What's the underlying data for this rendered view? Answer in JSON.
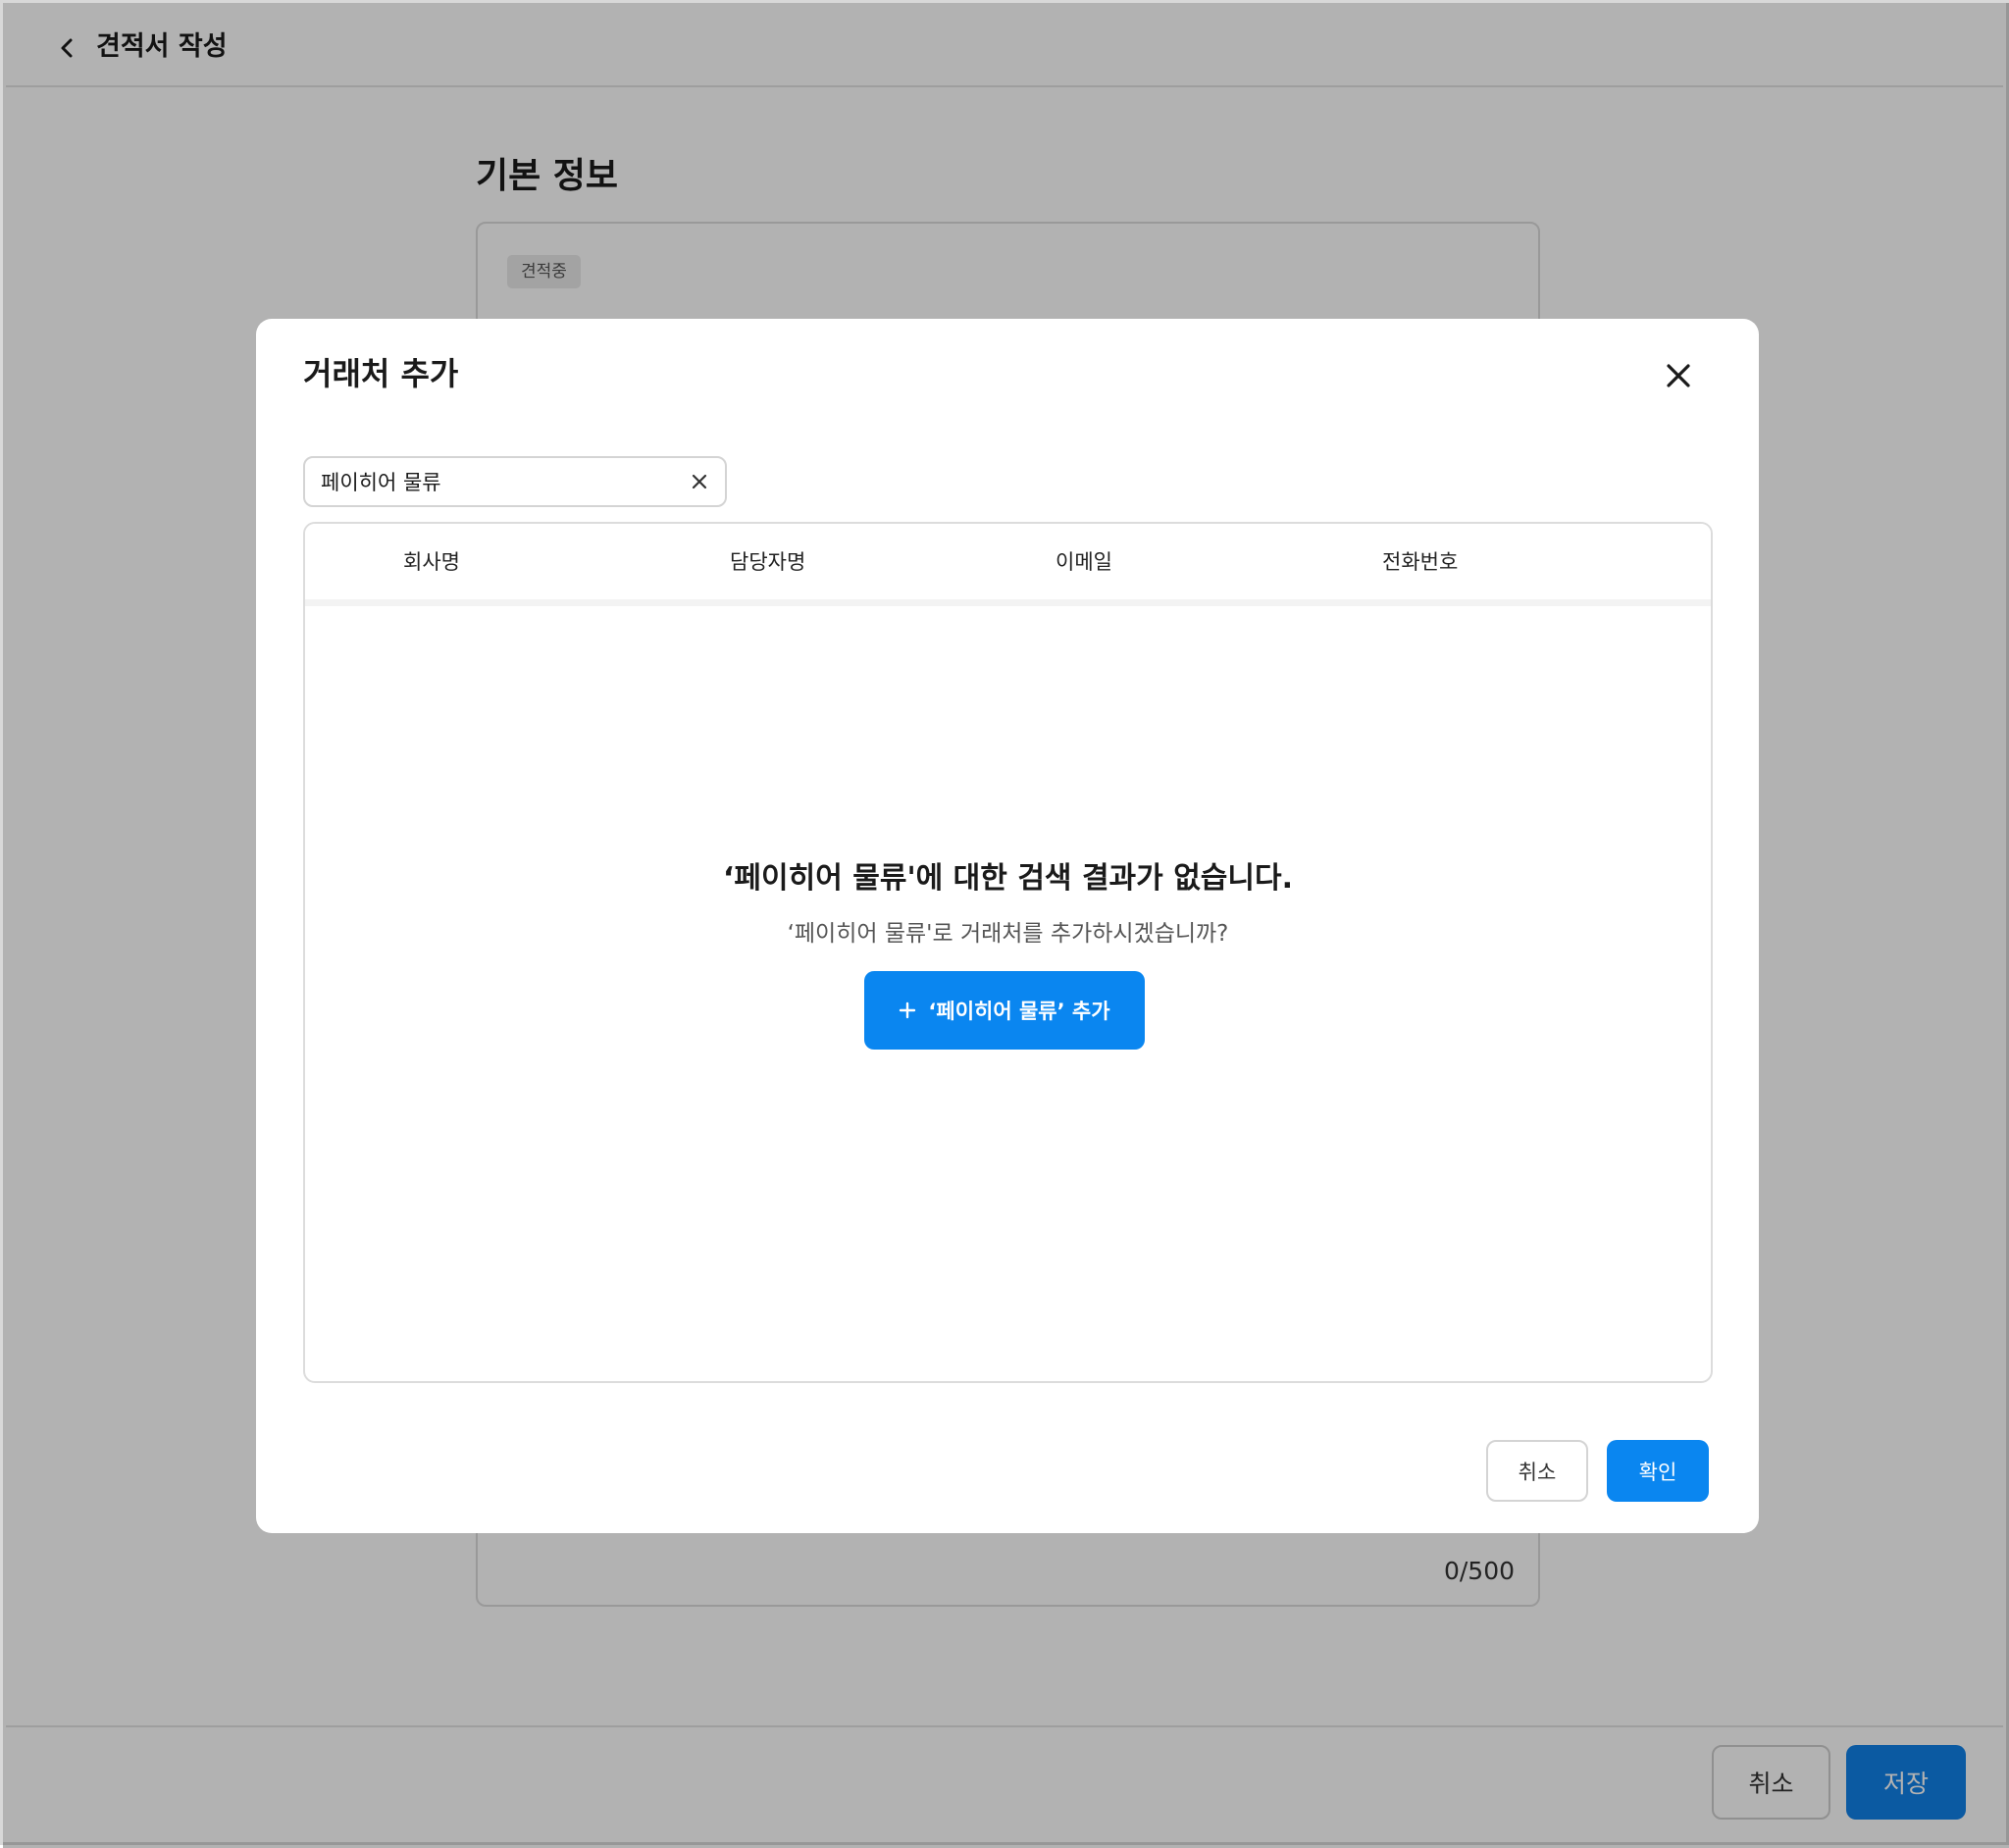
{
  "page": {
    "title": "견적서 작성",
    "section_title": "기본 정보",
    "status_badge": "견적중",
    "char_counter": "0/500",
    "footer": {
      "cancel_label": "취소",
      "save_label": "저장"
    }
  },
  "modal": {
    "title": "거래처 추가",
    "search": {
      "value": "페이히어 물류"
    },
    "table": {
      "columns": [
        "회사명",
        "담당자명",
        "이메일",
        "전화번호"
      ]
    },
    "empty_state": {
      "title": "‘페이히어 물류'에 대한 검색 결과가 없습니다.",
      "subtitle": "‘페이히어 물류'로 거래처를 추가하시겠습니까?",
      "add_button_label": "‘페이히어 물류’ 추가"
    },
    "footer": {
      "cancel_label": "취소",
      "confirm_label": "확인"
    }
  },
  "colors": {
    "primary": "#0a86f0",
    "overlay": "rgba(0,0,0,0.30)"
  },
  "icons": {
    "back": "chevron-left-icon",
    "close": "close-icon",
    "clear": "clear-icon",
    "add": "plus-icon"
  }
}
